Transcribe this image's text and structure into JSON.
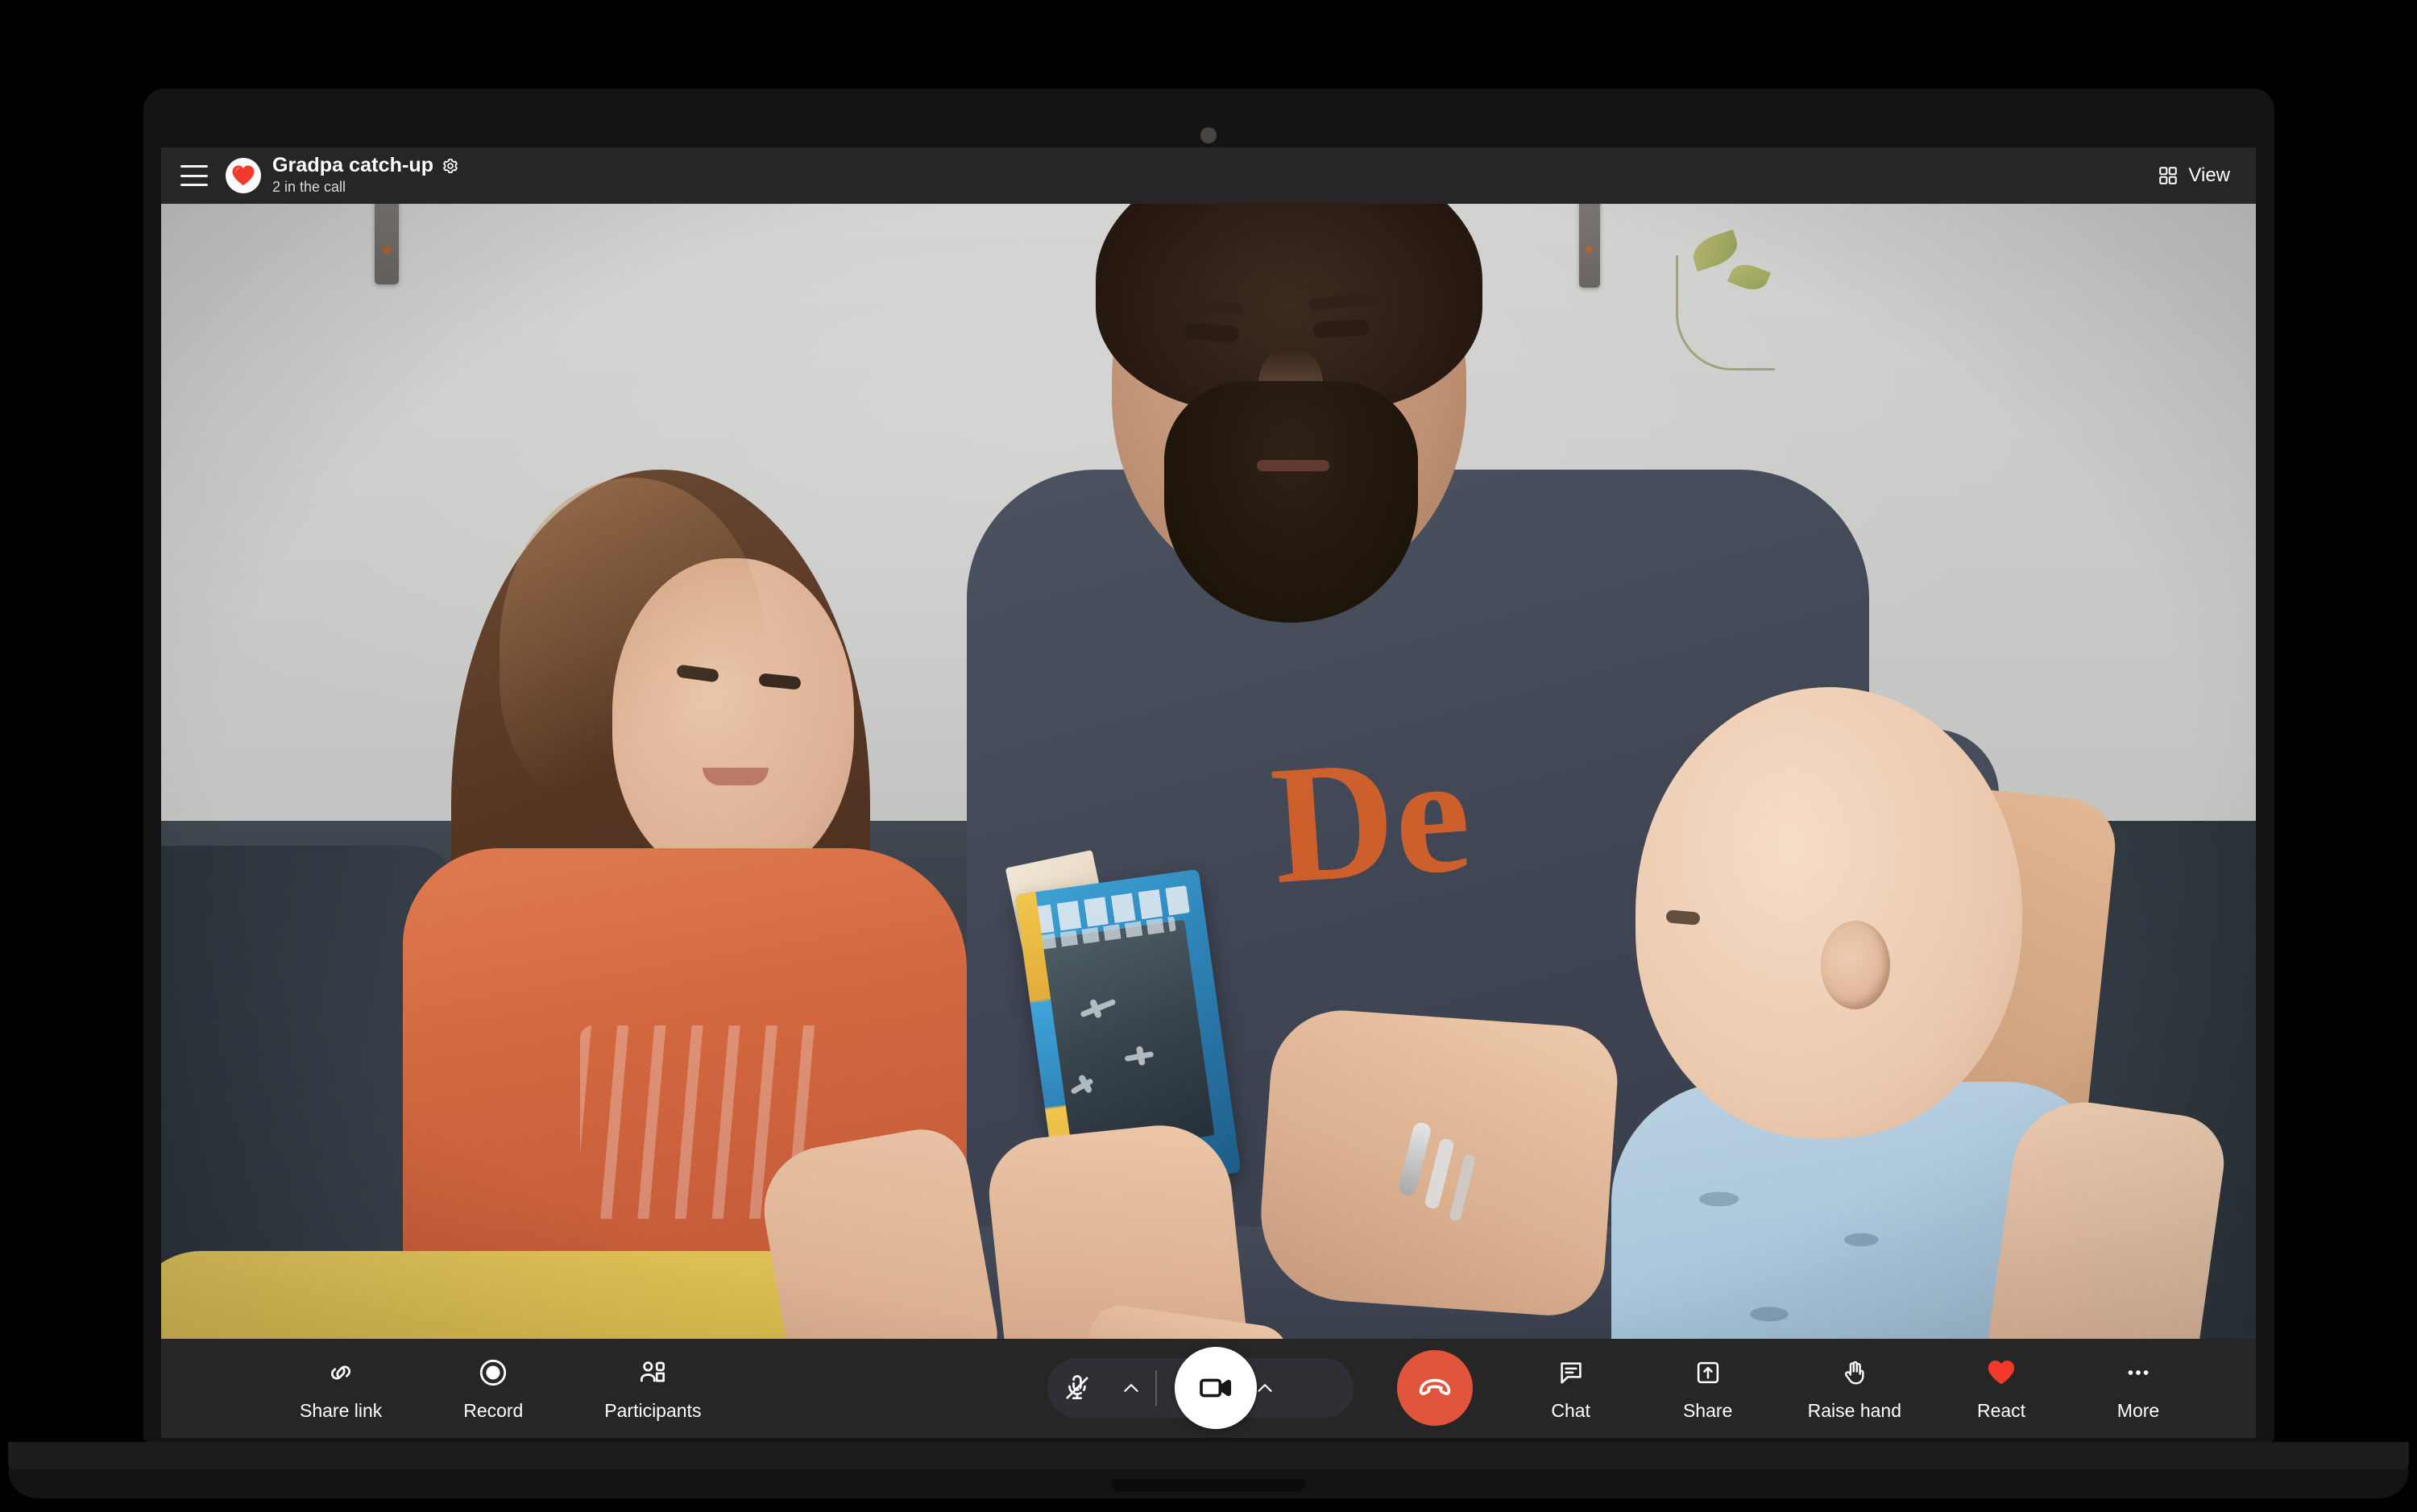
{
  "app": {
    "header": {
      "menu_icon": "hamburger-menu-icon",
      "logo_icon": "heart-logo-icon",
      "title": "Gradpa catch-up",
      "settings_icon": "gear-icon",
      "participants_status": "2 in the call",
      "view_button": {
        "label": "View",
        "icon": "grid-view-icon"
      }
    },
    "toolbar": {
      "left_items": [
        {
          "label": "Share link",
          "icon": "link-icon",
          "state": "inactive"
        },
        {
          "label": "Record",
          "icon": "record-icon",
          "state": "inactive"
        },
        {
          "label": "Participants",
          "icon": "participants-icon",
          "state": "inactive"
        }
      ],
      "call_controls": {
        "microphone": {
          "icon": "microphone-muted-icon",
          "label": "Microphone",
          "state": "muted"
        },
        "microphone_menu": {
          "icon": "chevron-up-icon",
          "label": "Audio options"
        },
        "camera": {
          "icon": "video-camera-icon",
          "label": "Camera",
          "state": "on"
        },
        "camera_menu": {
          "icon": "chevron-up-icon",
          "label": "Video options"
        },
        "hangup": {
          "icon": "end-call-icon",
          "label": "End call",
          "color": "#e0543c"
        }
      },
      "right_items": [
        {
          "label": "Chat",
          "icon": "chat-bubble-icon",
          "state": "inactive"
        },
        {
          "label": "Share",
          "icon": "share-screen-icon",
          "state": "inactive"
        },
        {
          "label": "Raise hand",
          "icon": "raised-hand-icon",
          "state": "inactive"
        },
        {
          "label": "React",
          "icon": "heart-icon",
          "state": "inactive"
        },
        {
          "label": "More",
          "icon": "ellipsis-icon",
          "state": "inactive"
        }
      ]
    },
    "video": {
      "description": "Video call feed showing a bearded man sitting on a dark couch reading a blue book to a young girl in an orange shirt on his left and a baby in a light blue shirt on his right",
      "alt_participants": "3 people on camera"
    },
    "colors": {
      "chrome_background": "#262626",
      "screen_background": "#1a1a1a",
      "laptop_body": "#141416",
      "accent_red": "#e0543c",
      "heart_red": "#f2392c",
      "pill_background": "#2f3035",
      "text_primary": "#ffffff",
      "text_secondary": "#d8d8d8"
    }
  }
}
